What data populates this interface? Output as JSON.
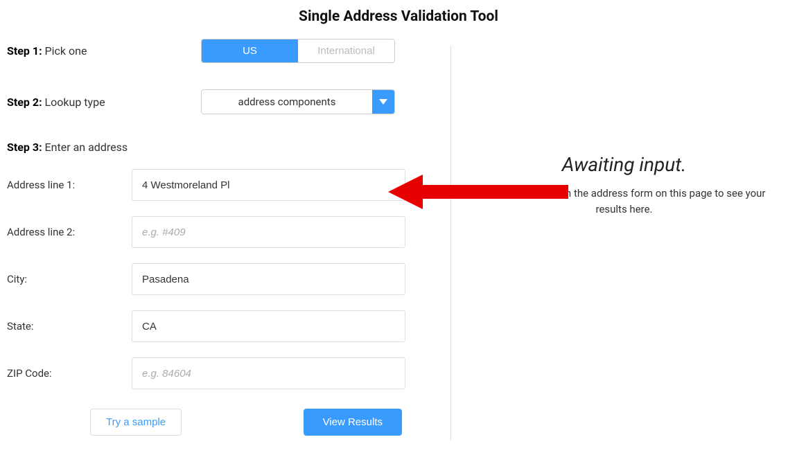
{
  "title": "Single Address Validation Tool",
  "step1": {
    "label_bold": "Step 1: ",
    "label_text": "Pick one",
    "options": [
      "US",
      "International"
    ],
    "active_index": 0
  },
  "step2": {
    "label_bold": "Step 2: ",
    "label_text": "Lookup type",
    "selected": "address components"
  },
  "step3": {
    "label_bold": "Step 3: ",
    "label_text": "Enter an address",
    "fields": {
      "line1": {
        "label": "Address line 1:",
        "value": "4 Westmoreland Pl",
        "placeholder": ""
      },
      "line2": {
        "label": "Address line 2:",
        "value": "",
        "placeholder": "e.g. #409"
      },
      "city": {
        "label": "City:",
        "value": "Pasadena",
        "placeholder": ""
      },
      "state": {
        "label": "State:",
        "value": "CA",
        "placeholder": ""
      },
      "zip": {
        "label": "ZIP Code:",
        "value": "",
        "placeholder": "e.g. 84604"
      }
    }
  },
  "buttons": {
    "sample": "Try a sample",
    "results": "View Results"
  },
  "right": {
    "title": "Awaiting input.",
    "text": "Enter an address in the address form on this page to see your results here."
  },
  "colors": {
    "accent": "#3a9bff",
    "arrow": "#e60000"
  }
}
